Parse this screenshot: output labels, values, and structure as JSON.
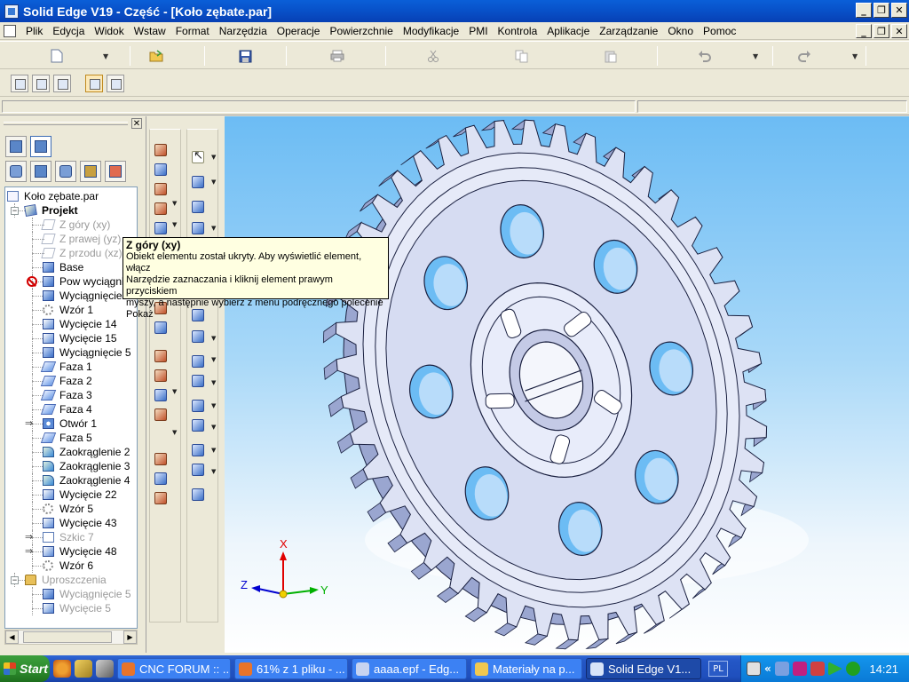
{
  "window": {
    "title": "Solid Edge V19 - Część - [Koło zębate.par]",
    "controls": {
      "minimize": "_",
      "restore": "❐",
      "close": "✕"
    }
  },
  "menu": {
    "items": [
      "Plik",
      "Edycja",
      "Widok",
      "Wstaw",
      "Format",
      "Narzędzia",
      "Operacje",
      "Powierzchnie",
      "Modyfikacje",
      "PMI",
      "Kontrola",
      "Aplikacje",
      "Zarządzanie",
      "Okno",
      "Pomoc"
    ]
  },
  "toolbar": {
    "icons": [
      "new-file-icon",
      "open-folder-icon",
      "save-icon",
      "print-icon",
      "cut-icon",
      "copy-icon",
      "paste-icon",
      "undo-icon",
      "redo-icon"
    ]
  },
  "pane": {
    "close_label": "✕"
  },
  "tree": {
    "items": [
      {
        "label": "Koło zębate.par",
        "icon": "part",
        "indent": 0
      },
      {
        "label": "Projekt",
        "icon": "proj",
        "indent": 1,
        "bold": true,
        "expander": "−"
      },
      {
        "label": "Z góry (xy)",
        "icon": "plane",
        "indent": 2,
        "gray": true
      },
      {
        "label": "Z prawej (yz)",
        "icon": "plane",
        "indent": 2,
        "gray": true
      },
      {
        "label": "Z przodu (xz)",
        "icon": "plane",
        "indent": 2,
        "gray": true
      },
      {
        "label": "Base",
        "icon": "feat",
        "indent": 2
      },
      {
        "label": "Pow wyciągnięcia",
        "icon": "feat",
        "indent": 2,
        "error": true
      },
      {
        "label": "Wyciągnięcie",
        "icon": "feat",
        "indent": 2
      },
      {
        "label": "Wzór 1",
        "icon": "pattern",
        "indent": 2
      },
      {
        "label": "Wycięcie 14",
        "icon": "cut",
        "indent": 2
      },
      {
        "label": "Wycięcie 15",
        "icon": "cut",
        "indent": 2
      },
      {
        "label": "Wyciągnięcie 5",
        "icon": "feat",
        "indent": 2
      },
      {
        "label": "Faza 1",
        "icon": "chamfer",
        "indent": 2
      },
      {
        "label": "Faza 2",
        "icon": "chamfer",
        "indent": 2
      },
      {
        "label": "Faza 3",
        "icon": "chamfer",
        "indent": 2
      },
      {
        "label": "Faza 4",
        "icon": "chamfer",
        "indent": 2
      },
      {
        "label": "Otwór 1",
        "icon": "hole",
        "indent": 2,
        "arrow": true
      },
      {
        "label": "Faza 5",
        "icon": "chamfer",
        "indent": 2
      },
      {
        "label": "Zaokrąglenie 2",
        "icon": "round",
        "indent": 2
      },
      {
        "label": "Zaokrąglenie 3",
        "icon": "round",
        "indent": 2
      },
      {
        "label": "Zaokrąglenie 4",
        "icon": "round",
        "indent": 2
      },
      {
        "label": "Wycięcie 22",
        "icon": "cut",
        "indent": 2
      },
      {
        "label": "Wzór 5",
        "icon": "pattern",
        "indent": 2
      },
      {
        "label": "Wycięcie 43",
        "icon": "cut",
        "indent": 2
      },
      {
        "label": "Szkic 7",
        "icon": "sketch",
        "indent": 2,
        "gray": true,
        "arrow": true
      },
      {
        "label": "Wycięcie 48",
        "icon": "cut",
        "indent": 2,
        "arrow": true
      },
      {
        "label": "Wzór 6",
        "icon": "pattern",
        "indent": 2
      },
      {
        "label": "Uproszczenia",
        "icon": "folder",
        "indent": 1,
        "gray": true,
        "expander": "−"
      },
      {
        "label": "Wyciągnięcie 5",
        "icon": "feat",
        "indent": 2,
        "gray": true
      },
      {
        "label": "Wycięcie 5",
        "icon": "cut",
        "indent": 2,
        "gray": true
      }
    ]
  },
  "tooltip": {
    "title": "Z góry (xy)",
    "lines": [
      "Obiekt elementu został ukryty. Aby wyświetlić element, włącz",
      "Narzędzie zaznaczania i kliknij element prawym przyciskiem",
      "myszy, a następnie wybierz z menu podręcznego polecenie",
      "Pokaż"
    ]
  },
  "axes": {
    "x": "X",
    "y": "Y",
    "z": "Z"
  },
  "colors": {
    "x_axis": "#e00000",
    "y_axis": "#00b000",
    "z_axis": "#0000d0",
    "gear_face": "#dde2f4",
    "gear_edge": "#1a2040",
    "gear_shadow": "#9aa6d0"
  },
  "taskbar": {
    "start_label": "Start",
    "tasks": [
      {
        "label": "CNC FORUM :: ...",
        "color": "#e8742a",
        "width": 128
      },
      {
        "label": "61% z 1 pliku - ...",
        "color": "#e8742a",
        "width": 128
      },
      {
        "label": "aaaa.epf - Edg...",
        "color": "#c8d4f0",
        "width": 130
      },
      {
        "label": "Materiały na p...",
        "color": "#f0c850",
        "width": 126
      },
      {
        "label": "Solid Edge V1...",
        "color": "#d8e4f8",
        "width": 130,
        "active": true
      }
    ],
    "lang": "PL",
    "clock": "14:21"
  }
}
